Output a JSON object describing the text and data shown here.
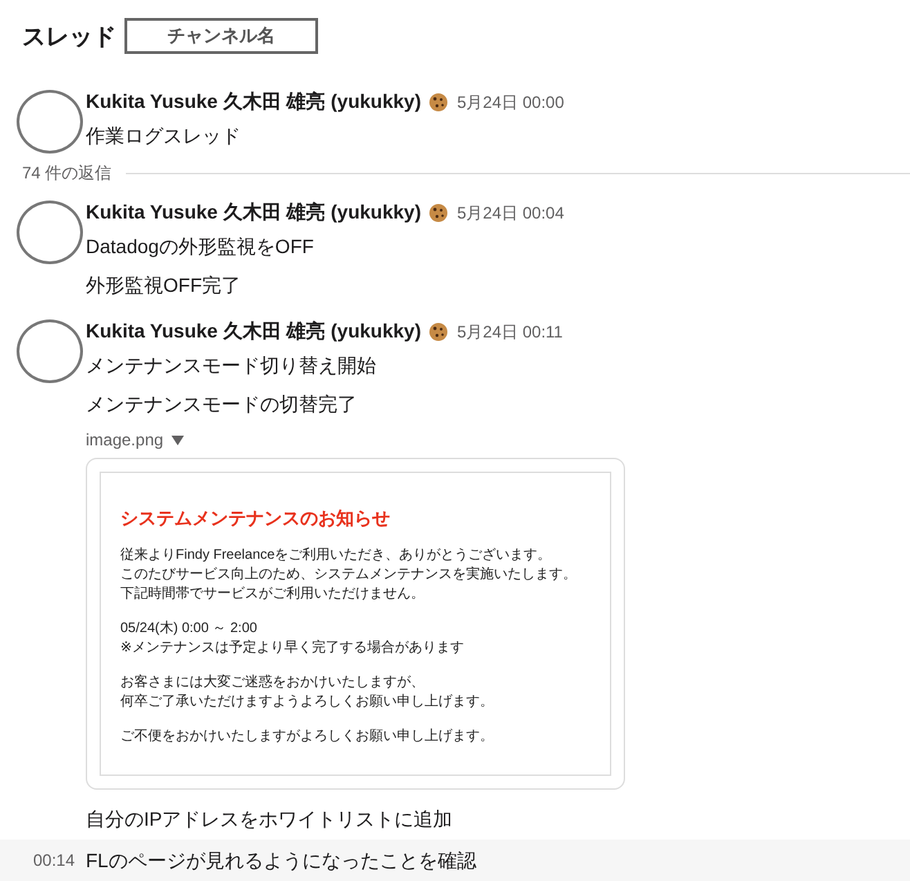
{
  "header": {
    "title": "スレッド",
    "channel": "チャンネル名"
  },
  "parent": {
    "author": "Kukita Yusuke 久木田 雄亮 (yukukky)",
    "time": "5月24日 00:00",
    "text": "作業ログスレッド"
  },
  "reply_count": "74 件の返信",
  "messages": [
    {
      "author": "Kukita Yusuke 久木田 雄亮 (yukukky)",
      "time": "5月24日 00:04",
      "text": "Datadogの外形監視をOFF",
      "lines": [
        {
          "kind": "text",
          "text": "外形監視OFF完了"
        }
      ]
    },
    {
      "author": "Kukita Yusuke 久木田 雄亮 (yukukky)",
      "time": "5月24日 00:11",
      "text": "メンテナンスモード切り替え開始",
      "lines": [
        {
          "kind": "text",
          "text": "メンテナンスモードの切替完了"
        },
        {
          "kind": "image",
          "filename": "image.png",
          "notice": {
            "title": "システムメンテナンスのお知らせ",
            "paragraphs": [
              [
                "従来よりFindy Freelanceをご利用いただき、ありがとうございます。",
                "このたびサービス向上のため、システムメンテナンスを実施いたします。",
                "下記時間帯でサービスがご利用いただけません。"
              ],
              [
                "05/24(木) 0:00 ～ 2:00",
                "※メンテナンスは予定より早く完了する場合があります"
              ],
              [
                "お客さまには大変ご迷惑をおかけいたしますが、",
                "何卒ご了承いただけますようよろしくお願い申し上げます。"
              ],
              [
                "ご不便をおかけいたしますがよろしくお願い申し上げます。"
              ]
            ]
          }
        },
        {
          "kind": "text",
          "text": "自分のIPアドレスをホワイトリストに追加"
        },
        {
          "kind": "text",
          "text": "FLのページが見れるようになったことを確認",
          "time": "00:14",
          "hovered": true
        }
      ]
    }
  ]
}
